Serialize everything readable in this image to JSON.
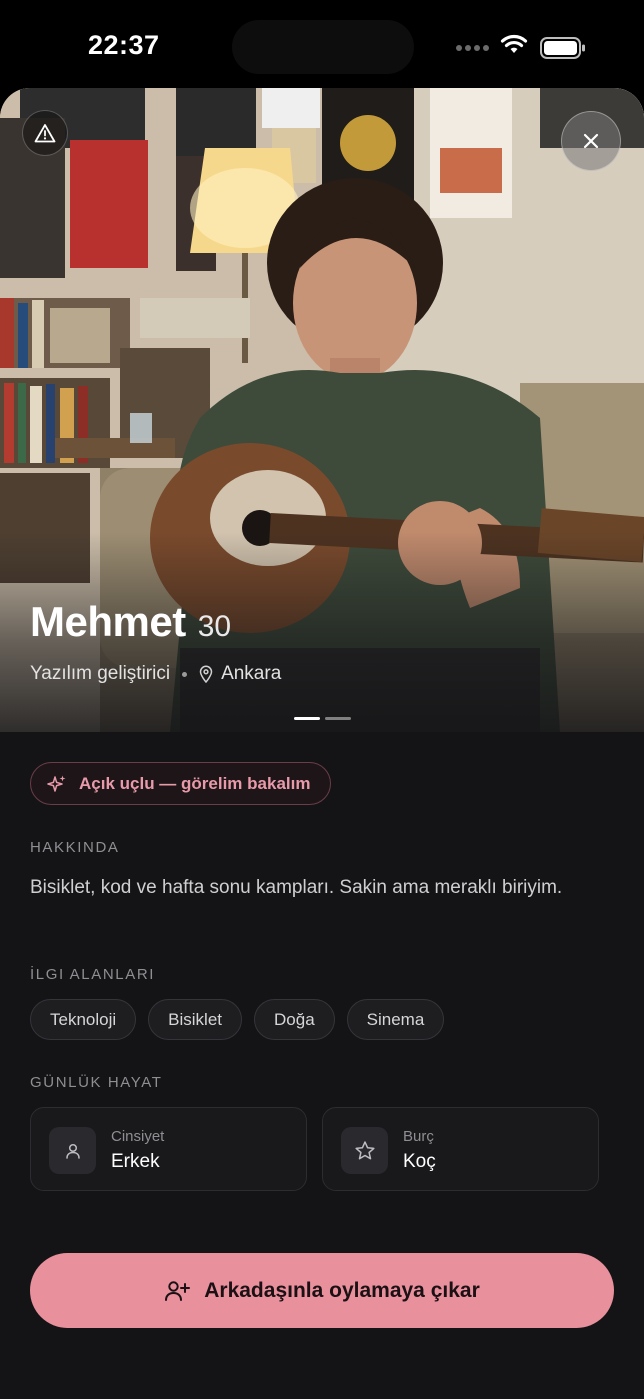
{
  "status_bar": {
    "time": "22:37"
  },
  "profile": {
    "name": "Mehmet",
    "age": "30",
    "occupation": "Yazılım geliştirici",
    "location": "Ankara",
    "photo_count": 2,
    "current_photo": 1
  },
  "intent": {
    "label": "Açık uçlu — görelim bakalım",
    "icon": "sparkles-icon"
  },
  "about": {
    "title": "HAKKINDA",
    "text": "Bisiklet, kod ve hafta sonu kampları. Sakin ama meraklı biriyim."
  },
  "interests": {
    "title": "İLGI ALANLARI",
    "items": [
      "Teknoloji",
      "Bisiklet",
      "Doğa",
      "Sinema"
    ]
  },
  "daily_life": {
    "title": "GÜNLÜK HAYAT",
    "cards": [
      {
        "label": "Cinsiyet",
        "value": "Erkek",
        "icon": "person-icon"
      },
      {
        "label": "Burç",
        "value": "Koç",
        "icon": "star-icon"
      }
    ]
  },
  "cta": {
    "label": "Arkadaşınla oylamaya çıkar",
    "icon": "user-plus-icon"
  },
  "colors": {
    "background": "#141416",
    "accent": "#e8909c",
    "accent_text": "#e89aa9",
    "muted": "#8e8e93"
  }
}
